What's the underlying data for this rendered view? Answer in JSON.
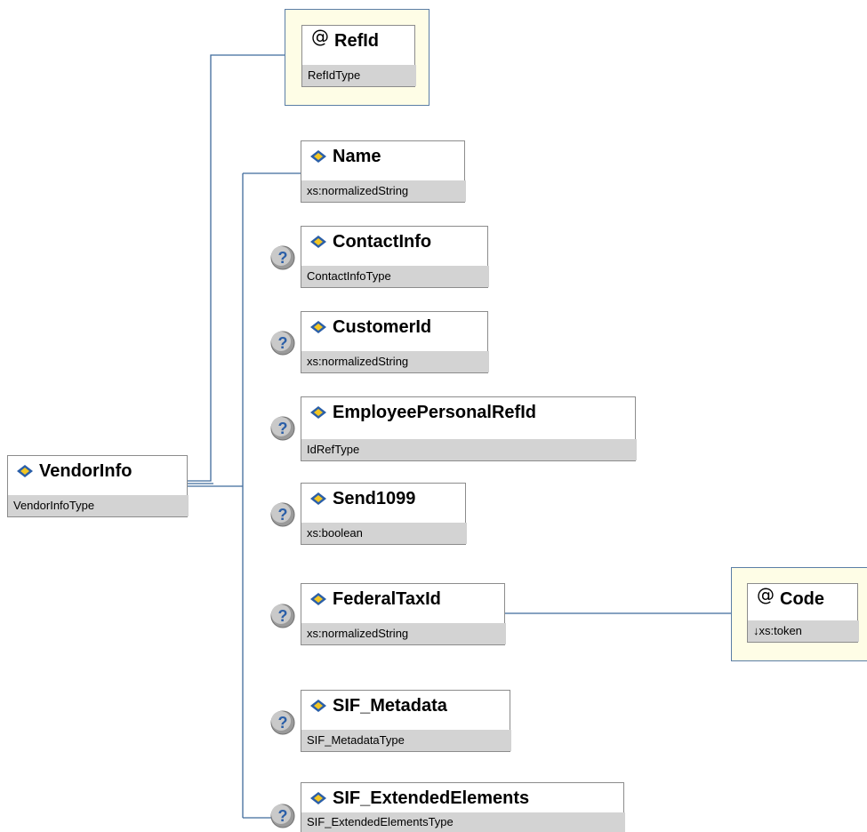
{
  "colors": {
    "connector": "#3f6a9c",
    "type_strip": "#d3d3d3",
    "attribute_frame_bg": "#fefde6",
    "attribute_frame_border": "#5b7ea6",
    "element_icon_blue": "#2b5fa8",
    "element_icon_yellow": "#f3c623",
    "optional_badge": "#9a9a9a"
  },
  "root": {
    "name": "VendorInfo",
    "type": "VendorInfoType",
    "icon": "element-icon"
  },
  "attribute_refid": {
    "name": "RefId",
    "type": "RefIdType",
    "icon": "at-icon"
  },
  "children": [
    {
      "name": "Name",
      "type": "xs:normalizedString",
      "optional": false,
      "icon": "element-icon"
    },
    {
      "name": "ContactInfo",
      "type": "ContactInfoType",
      "optional": true,
      "icon": "element-icon"
    },
    {
      "name": "CustomerId",
      "type": "xs:normalizedString",
      "optional": true,
      "icon": "element-icon"
    },
    {
      "name": "EmployeePersonalRefId",
      "type": "IdRefType",
      "optional": true,
      "icon": "element-icon"
    },
    {
      "name": "Send1099",
      "type": "xs:boolean",
      "optional": true,
      "icon": "element-icon"
    },
    {
      "name": "FederalTaxId",
      "type": "xs:normalizedString",
      "optional": true,
      "icon": "element-icon"
    },
    {
      "name": "SIF_Metadata",
      "type": "SIF_MetadataType",
      "optional": true,
      "icon": "element-icon"
    },
    {
      "name": "SIF_ExtendedElements",
      "type": "SIF_ExtendedElementsType",
      "optional": true,
      "icon": "element-icon"
    }
  ],
  "attribute_code": {
    "at": "@",
    "name": "Code",
    "type": "↓xs:token",
    "icon": "at-icon"
  },
  "at_symbol": "@",
  "optional_symbol": "?"
}
